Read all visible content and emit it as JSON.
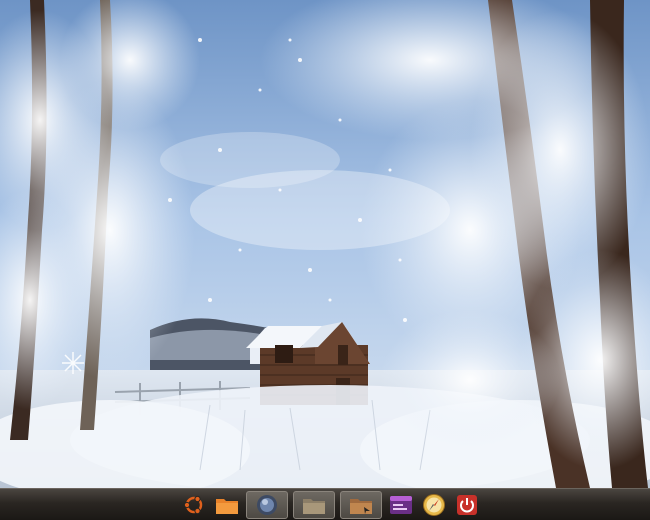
{
  "desktop": {
    "wallpaper": "winter-cabin-snowy-trees",
    "colors": {
      "sky": "#a9c4e6",
      "snow": "#f1f5fb",
      "cabin": "#5c3a28",
      "dock": "#2a2622"
    }
  },
  "dock": {
    "items": [
      {
        "icon": "ubuntu-logo-icon",
        "kind": "launcher"
      },
      {
        "icon": "orange-folder-icon",
        "kind": "launcher"
      },
      {
        "icon": "gray-orb-window-icon",
        "kind": "window"
      },
      {
        "icon": "folder-window-icon",
        "kind": "window"
      },
      {
        "icon": "folder-window-icon",
        "kind": "window"
      },
      {
        "icon": "purple-window-icon",
        "kind": "launcher"
      },
      {
        "icon": "compass-browser-icon",
        "kind": "launcher"
      },
      {
        "icon": "power-icon",
        "kind": "launcher"
      }
    ]
  }
}
